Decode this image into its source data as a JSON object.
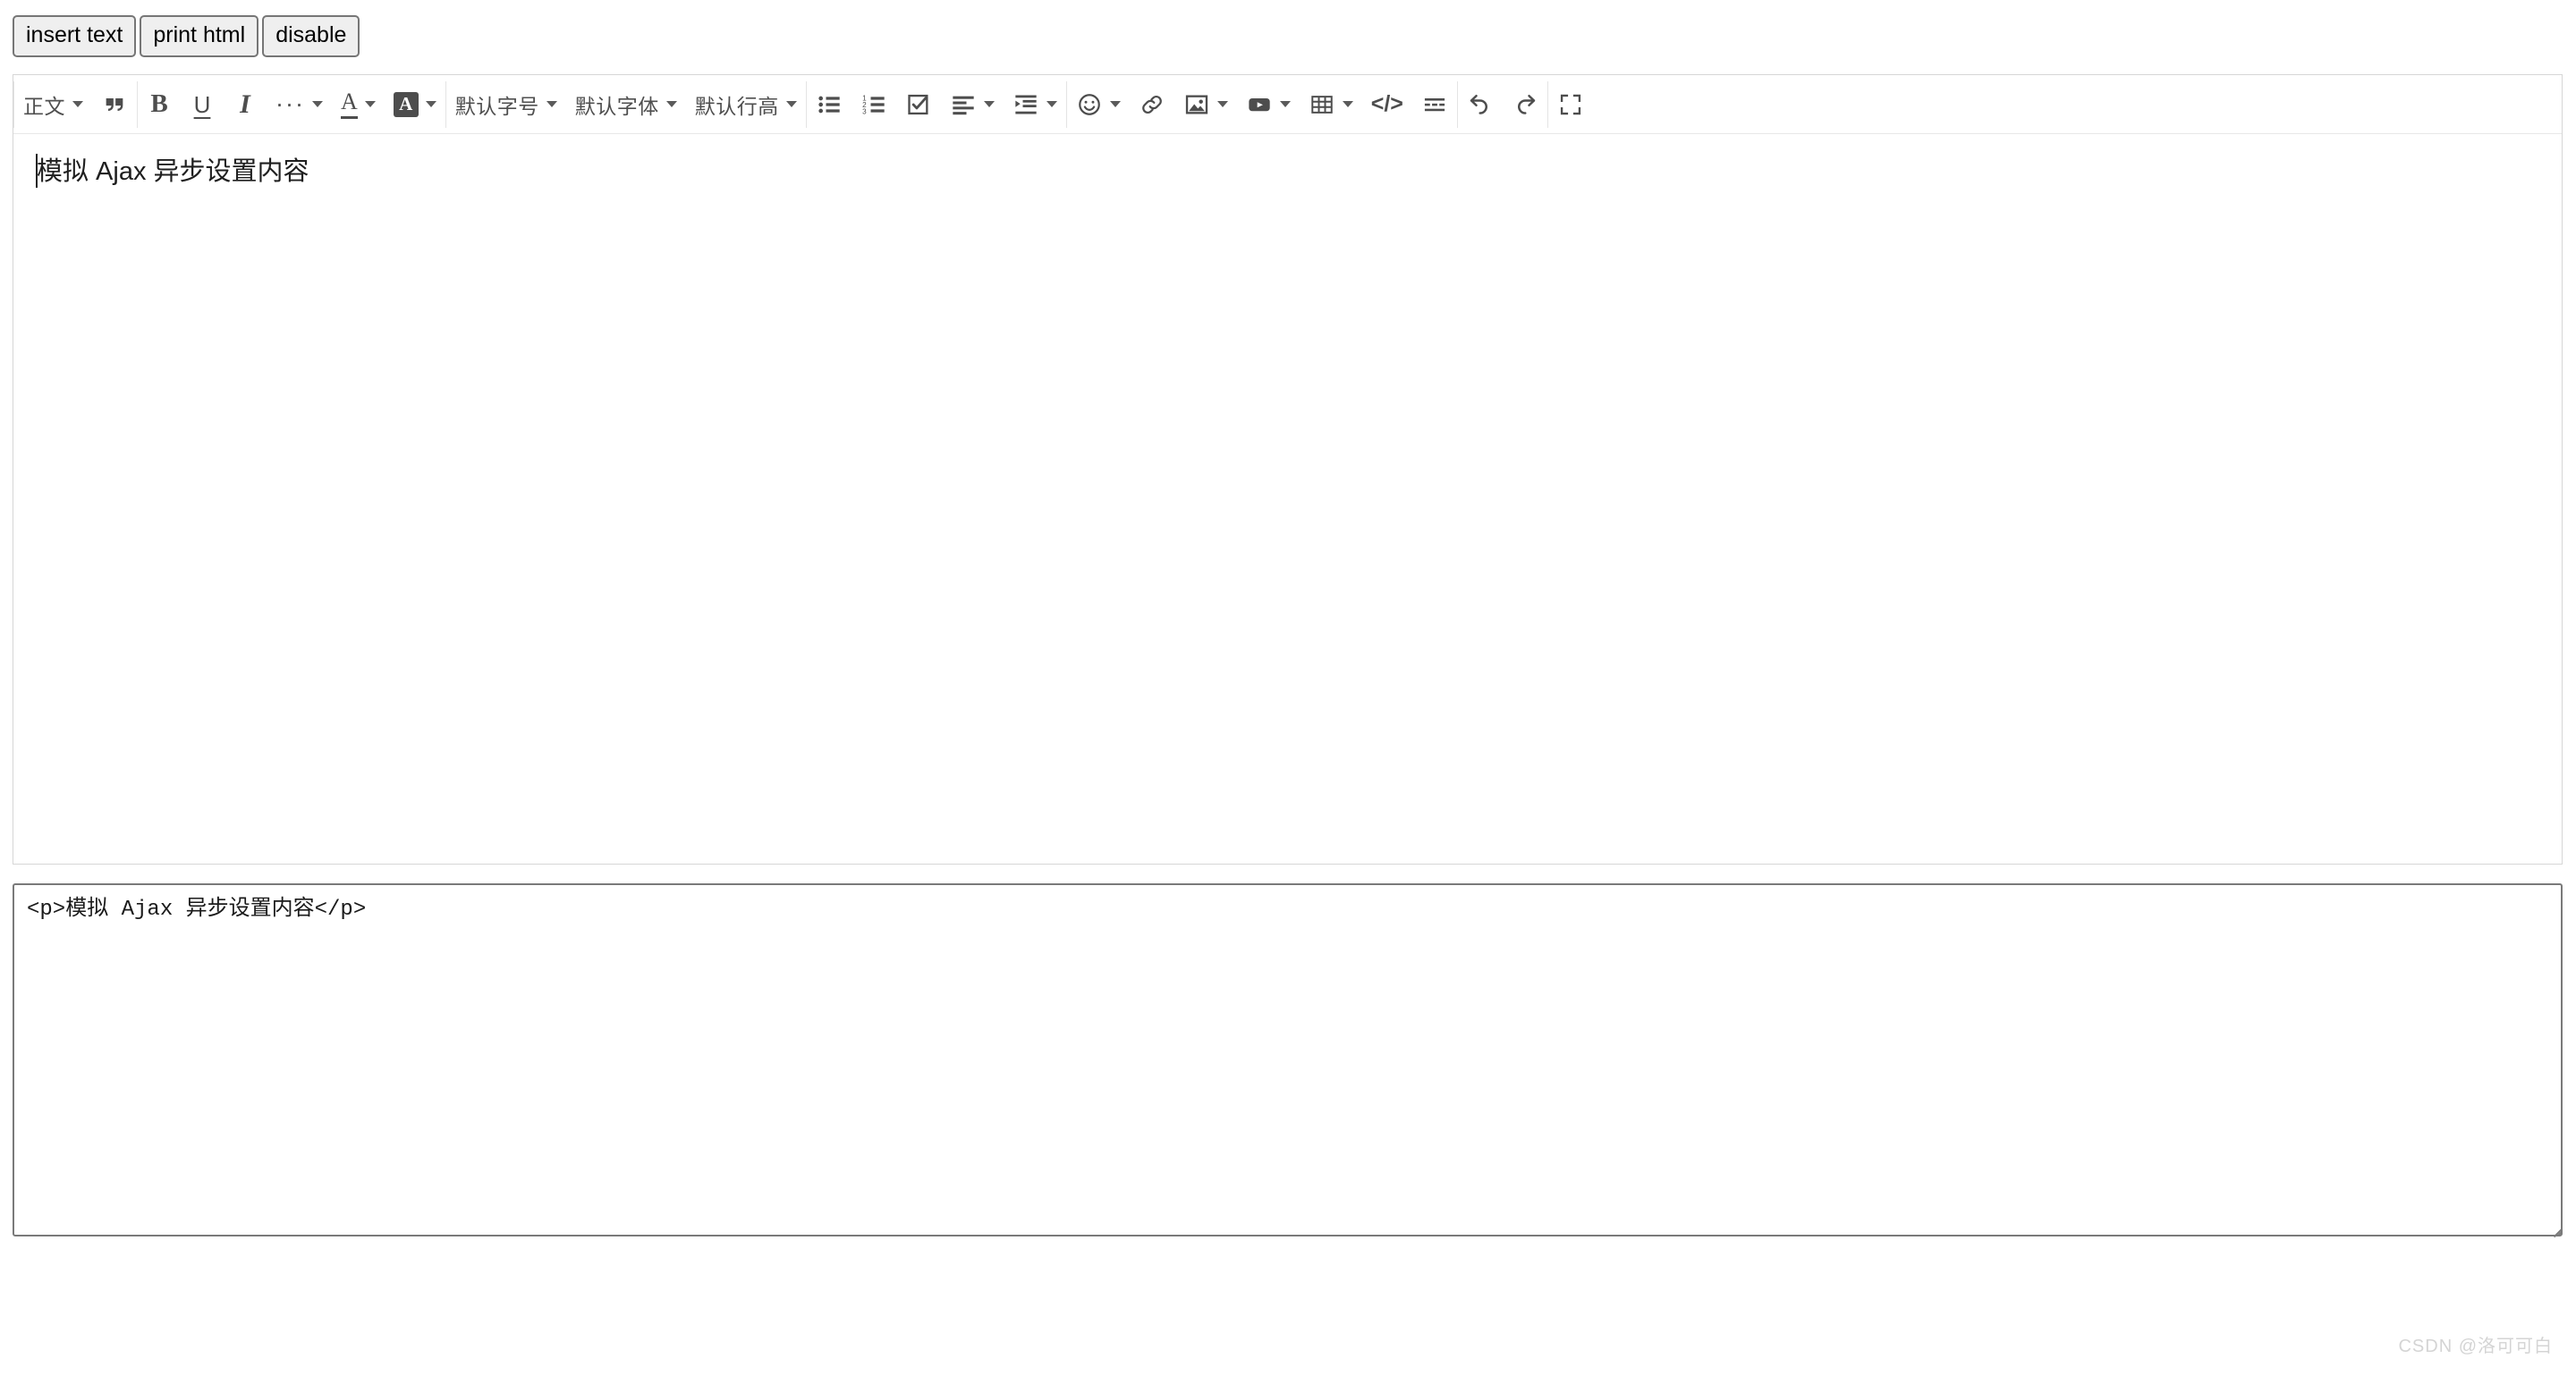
{
  "demo_buttons": [
    {
      "label": "insert text",
      "name": "insert-text-button"
    },
    {
      "label": "print html",
      "name": "print-html-button"
    },
    {
      "label": "disable",
      "name": "disable-button"
    }
  ],
  "toolbar": {
    "groups": [
      {
        "items": [
          {
            "label": "正文",
            "icon": "paragraph-style-dropdown",
            "caret": true
          },
          {
            "label": "",
            "icon": "blockquote-icon",
            "caret": false
          }
        ]
      },
      {
        "items": [
          {
            "label": "B",
            "icon": "bold-icon",
            "caret": false
          },
          {
            "label": "U",
            "icon": "underline-icon",
            "caret": false
          },
          {
            "label": "I",
            "icon": "italic-icon",
            "caret": false
          },
          {
            "label": "···",
            "icon": "more-text-formats-icon",
            "caret": true
          },
          {
            "label": "A",
            "icon": "font-color-icon",
            "caret": true
          },
          {
            "label": "A",
            "icon": "background-color-icon",
            "caret": true
          }
        ]
      },
      {
        "items": [
          {
            "label": "默认字号",
            "icon": "font-size-dropdown",
            "caret": true
          },
          {
            "label": "默认字体",
            "icon": "font-family-dropdown",
            "caret": true
          },
          {
            "label": "默认行高",
            "icon": "line-height-dropdown",
            "caret": true
          }
        ]
      },
      {
        "items": [
          {
            "label": "",
            "icon": "bullet-list-icon",
            "caret": false
          },
          {
            "label": "",
            "icon": "numbered-list-icon",
            "caret": false
          },
          {
            "label": "",
            "icon": "todo-list-icon",
            "caret": false
          },
          {
            "label": "",
            "icon": "align-left-icon",
            "caret": true
          },
          {
            "label": "",
            "icon": "indent-icon",
            "caret": true
          }
        ]
      },
      {
        "items": [
          {
            "label": "",
            "icon": "emoji-icon",
            "caret": true
          },
          {
            "label": "",
            "icon": "link-icon",
            "caret": false
          },
          {
            "label": "",
            "icon": "image-icon",
            "caret": true
          },
          {
            "label": "",
            "icon": "video-icon",
            "caret": true
          },
          {
            "label": "",
            "icon": "table-icon",
            "caret": true
          },
          {
            "label": "",
            "icon": "code-block-icon",
            "caret": false
          },
          {
            "label": "",
            "icon": "divider-icon",
            "caret": false
          }
        ]
      },
      {
        "items": [
          {
            "label": "",
            "icon": "undo-icon",
            "caret": false
          },
          {
            "label": "",
            "icon": "redo-icon",
            "caret": false
          }
        ]
      },
      {
        "items": [
          {
            "label": "",
            "icon": "fullscreen-icon",
            "caret": false
          }
        ]
      }
    ]
  },
  "editor": {
    "content_text": "模拟 Ajax 异步设置内容"
  },
  "html_output": {
    "value": "<p>模拟 Ajax 异步设置内容</p>"
  },
  "watermark": {
    "text": "CSDN @洛可可白"
  },
  "colors": {
    "icon": "#4d4d4d",
    "label": "#4f4f4f",
    "border": "#d6d6d6",
    "separator": "#e4e4e4",
    "textarea_border": "#7a7a7a",
    "button_face": "#efefef",
    "button_border": "#767676",
    "watermark": "#d4d4d4"
  }
}
